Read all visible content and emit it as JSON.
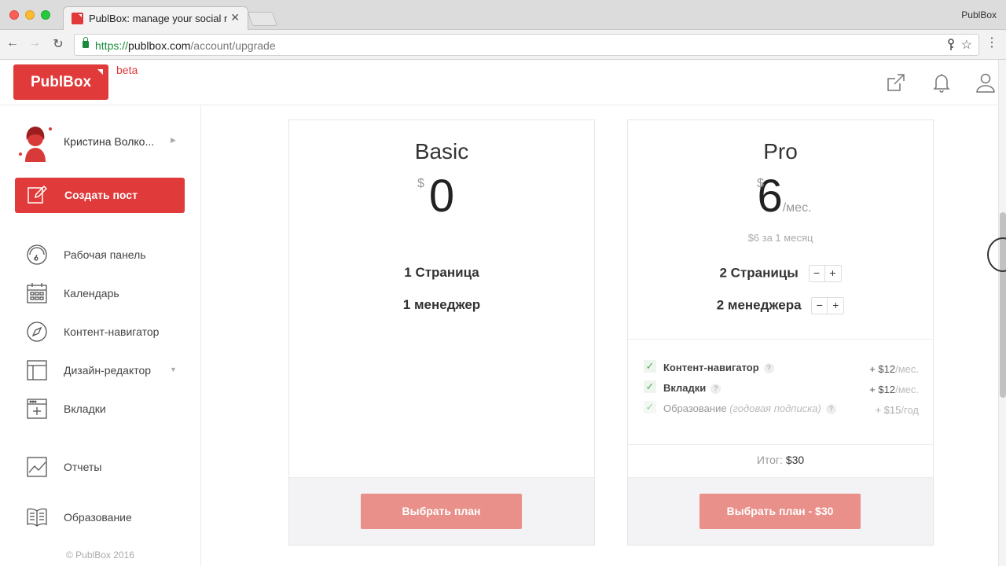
{
  "browser": {
    "tab_title": "PublBox: manage your social n",
    "profile_name": "PublBox",
    "url_scheme": "https://",
    "url_host": "publbox.com",
    "url_path": "/account/upgrade"
  },
  "header": {
    "logo_text": "PublBox",
    "beta_label": "beta"
  },
  "sidebar": {
    "user_name": "Кристина Волко...",
    "create_post_label": "Создать пост",
    "items": [
      {
        "label": "Рабочая панель",
        "icon": "dashboard-icon"
      },
      {
        "label": "Календарь",
        "icon": "calendar-icon"
      },
      {
        "label": "Контент-навигатор",
        "icon": "compass-icon"
      },
      {
        "label": "Дизайн-редактор",
        "icon": "layout-icon"
      },
      {
        "label": "Вкладки",
        "icon": "tab-add-icon"
      },
      {
        "label": "Отчеты",
        "icon": "chart-icon"
      },
      {
        "label": "Образование",
        "icon": "book-icon"
      }
    ],
    "copyright": "© PublBox 2016"
  },
  "plans": {
    "basic": {
      "name": "Basic",
      "currency": "$",
      "price": "0",
      "limits": [
        "1 Страница",
        "1 менеджер"
      ],
      "button_label": "Выбрать план"
    },
    "pro": {
      "name": "Pro",
      "currency": "$",
      "price": "6",
      "period": "/мес.",
      "price_note": "$6 за 1 месяц",
      "pages_label": "2 Страницы",
      "managers_label": "2 менеджера",
      "stepper_minus": "−",
      "stepper_plus": "+",
      "addons": [
        {
          "label": "Контент-навигатор",
          "note": "",
          "price": "+ $12",
          "unit": "/мес.",
          "enabled": true
        },
        {
          "label": "Вкладки",
          "note": "",
          "price": "+ $12",
          "unit": "/мес.",
          "enabled": true
        },
        {
          "label": "Образование",
          "note": "(годовая подписка)",
          "price": "+ $15",
          "unit": "/год",
          "enabled": false
        }
      ],
      "help_glyph": "?",
      "total_label": "Итог:",
      "total_value": "$30",
      "button_label": "Выбрать план - $30"
    }
  },
  "colors": {
    "brand": "#e03a3a",
    "button_soft": "#e89089",
    "check": "#4caf50"
  }
}
